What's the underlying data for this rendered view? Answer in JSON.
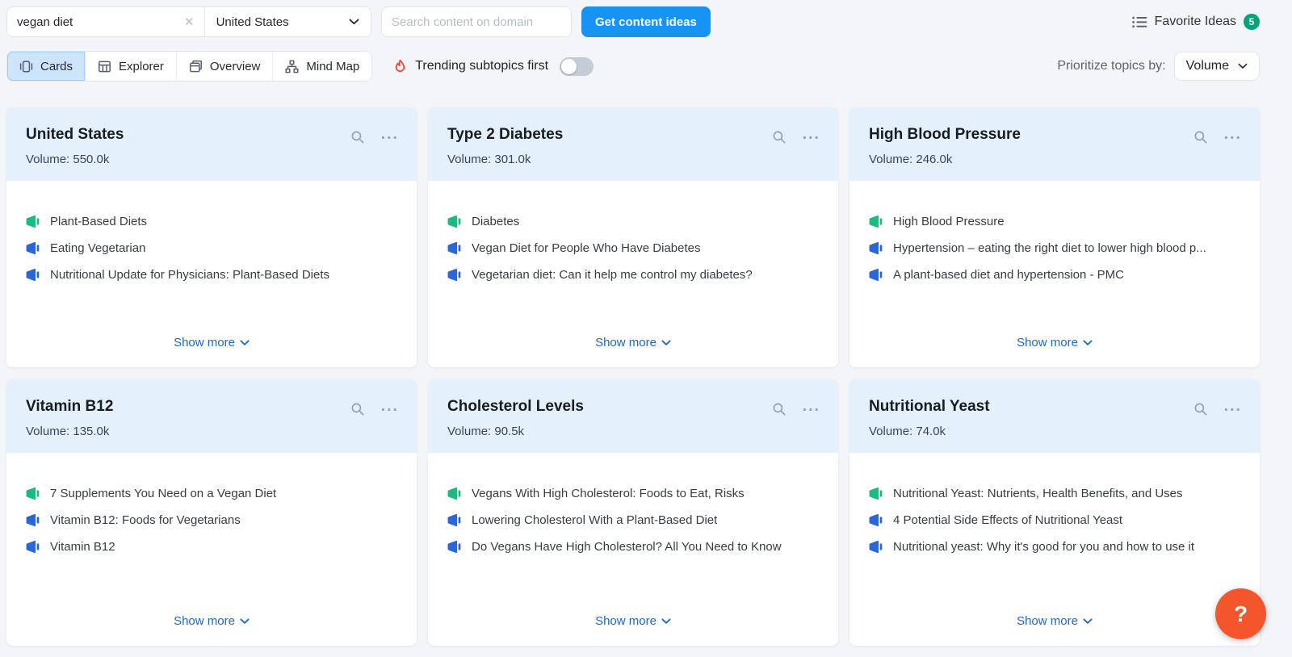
{
  "topbar": {
    "keyword_value": "vegan diet",
    "database_value": "United States",
    "domain_placeholder": "Search content on domain",
    "cta_label": "Get content ideas",
    "favorites_label": "Favorite Ideas",
    "favorites_count": "5"
  },
  "toolbar": {
    "tabs": [
      {
        "label": "Cards",
        "active": true
      },
      {
        "label": "Explorer",
        "active": false
      },
      {
        "label": "Overview",
        "active": false
      },
      {
        "label": "Mind Map",
        "active": false
      }
    ],
    "trending_label": "Trending subtopics first",
    "trending_on": false,
    "prioritize_label": "Prioritize topics by:",
    "prioritize_value": "Volume"
  },
  "strings": {
    "volume_label": "Volume:",
    "show_more": "Show more",
    "help_label": "?"
  },
  "cards": [
    {
      "title": "United States",
      "volume": "550.0k",
      "items": [
        {
          "text": "Plant-Based Diets",
          "type": "topic"
        },
        {
          "text": "Eating Vegetarian",
          "type": "idea"
        },
        {
          "text": "Nutritional Update for Physicians: Plant-Based Diets",
          "type": "idea"
        }
      ]
    },
    {
      "title": "Type 2 Diabetes",
      "volume": "301.0k",
      "items": [
        {
          "text": "Diabetes",
          "type": "topic"
        },
        {
          "text": "Vegan Diet for People Who Have Diabetes",
          "type": "idea"
        },
        {
          "text": "Vegetarian diet: Can it help me control my diabetes?",
          "type": "idea"
        }
      ]
    },
    {
      "title": "High Blood Pressure",
      "volume": "246.0k",
      "items": [
        {
          "text": "High Blood Pressure",
          "type": "topic"
        },
        {
          "text": "Hypertension – eating the right diet to lower high blood p...",
          "type": "idea"
        },
        {
          "text": "A plant-based diet and hypertension - PMC",
          "type": "idea"
        }
      ]
    },
    {
      "title": "Vitamin B12",
      "volume": "135.0k",
      "items": [
        {
          "text": "7 Supplements You Need on a Vegan Diet",
          "type": "topic"
        },
        {
          "text": "Vitamin B12: Foods for Vegetarians",
          "type": "idea"
        },
        {
          "text": "Vitamin B12",
          "type": "idea"
        }
      ]
    },
    {
      "title": "Cholesterol Levels",
      "volume": "90.5k",
      "items": [
        {
          "text": "Vegans With High Cholesterol: Foods to Eat, Risks",
          "type": "topic"
        },
        {
          "text": "Lowering Cholesterol With a Plant-Based Diet",
          "type": "idea"
        },
        {
          "text": "Do Vegans Have High Cholesterol? All You Need to Know",
          "type": "idea"
        }
      ]
    },
    {
      "title": "Nutritional Yeast",
      "volume": "74.0k",
      "items": [
        {
          "text": "Nutritional Yeast: Nutrients, Health Benefits, and Uses",
          "type": "topic"
        },
        {
          "text": "4 Potential Side Effects of Nutritional Yeast",
          "type": "idea"
        },
        {
          "text": "Nutritional yeast: Why it's good for you and how to use it",
          "type": "idea"
        }
      ]
    }
  ],
  "colors": {
    "accent_blue": "#1793f5",
    "link_blue": "#1c68cb",
    "topic_green": "#15bd7e",
    "idea_blue": "#2766db",
    "flame_red": "#f0463c",
    "help_orange": "#f4552a",
    "badge_green": "#00a37a",
    "card_header_blue": "#e4f1fc",
    "tab_active_bg": "#cde5fb"
  }
}
